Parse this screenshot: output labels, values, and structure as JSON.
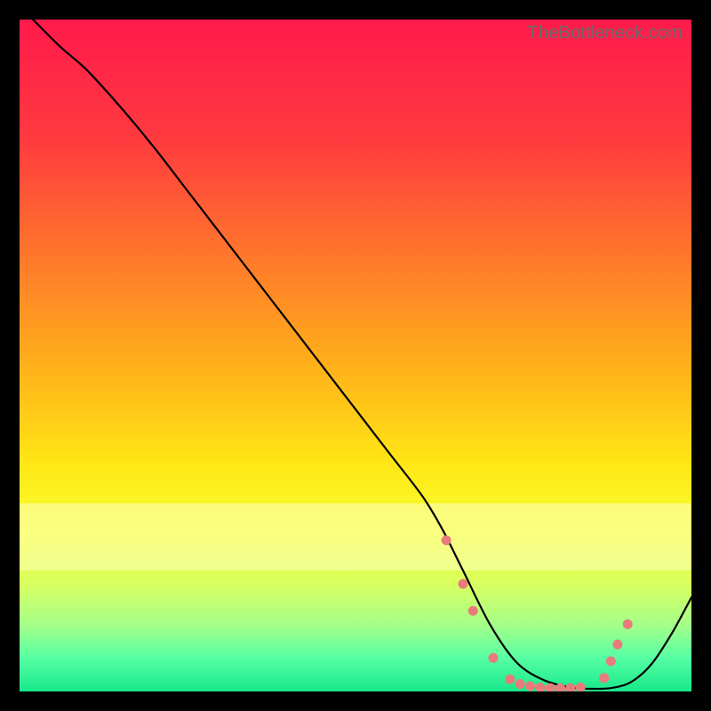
{
  "watermark": "TheBottleneck.com",
  "chart_data": {
    "type": "line",
    "title": "",
    "xlabel": "",
    "ylabel": "",
    "xlim": [
      0,
      100
    ],
    "ylim": [
      0,
      100
    ],
    "background_gradient": {
      "stops": [
        {
          "offset": 0.0,
          "color": "#ff1a4b"
        },
        {
          "offset": 0.18,
          "color": "#ff3a3f"
        },
        {
          "offset": 0.36,
          "color": "#ff7a2a"
        },
        {
          "offset": 0.52,
          "color": "#ffb21a"
        },
        {
          "offset": 0.66,
          "color": "#ffe615"
        },
        {
          "offset": 0.76,
          "color": "#f7ff30"
        },
        {
          "offset": 0.84,
          "color": "#d8ff60"
        },
        {
          "offset": 0.9,
          "color": "#a6ff88"
        },
        {
          "offset": 0.95,
          "color": "#57ffa4"
        },
        {
          "offset": 1.0,
          "color": "#17e88b"
        }
      ],
      "pale_band": {
        "y_from": 72,
        "y_to": 82,
        "color": "#fdffc0"
      }
    },
    "series": [
      {
        "name": "curve",
        "color": "#000000",
        "stroke_width": 2.2,
        "x": [
          2,
          6,
          10,
          15,
          20,
          25,
          30,
          35,
          40,
          45,
          50,
          55,
          60,
          63,
          66,
          70,
          74,
          78,
          82,
          85,
          88,
          91,
          94,
          97,
          100
        ],
        "y": [
          100,
          96,
          92.5,
          87,
          81,
          74.5,
          68,
          61.5,
          55,
          48.5,
          42,
          35.5,
          29,
          24,
          18,
          10,
          4.3,
          1.7,
          0.6,
          0.4,
          0.5,
          1.4,
          4.0,
          8.5,
          14
        ]
      }
    ],
    "markers": {
      "color": "#e87b7b",
      "radius": 5.5,
      "points": [
        {
          "x": 63.5,
          "y": 22.5
        },
        {
          "x": 66.0,
          "y": 16.0
        },
        {
          "x": 67.5,
          "y": 12.0
        },
        {
          "x": 70.5,
          "y": 5.0
        },
        {
          "x": 73.0,
          "y": 1.8
        },
        {
          "x": 74.5,
          "y": 1.1
        },
        {
          "x": 76.0,
          "y": 0.8
        },
        {
          "x": 77.5,
          "y": 0.6
        },
        {
          "x": 79.0,
          "y": 0.5
        },
        {
          "x": 80.5,
          "y": 0.5
        },
        {
          "x": 82.0,
          "y": 0.5
        },
        {
          "x": 83.5,
          "y": 0.6
        },
        {
          "x": 87.0,
          "y": 2.0
        },
        {
          "x": 88.0,
          "y": 4.5
        },
        {
          "x": 89.0,
          "y": 7.0
        },
        {
          "x": 90.5,
          "y": 10.0
        }
      ]
    }
  }
}
